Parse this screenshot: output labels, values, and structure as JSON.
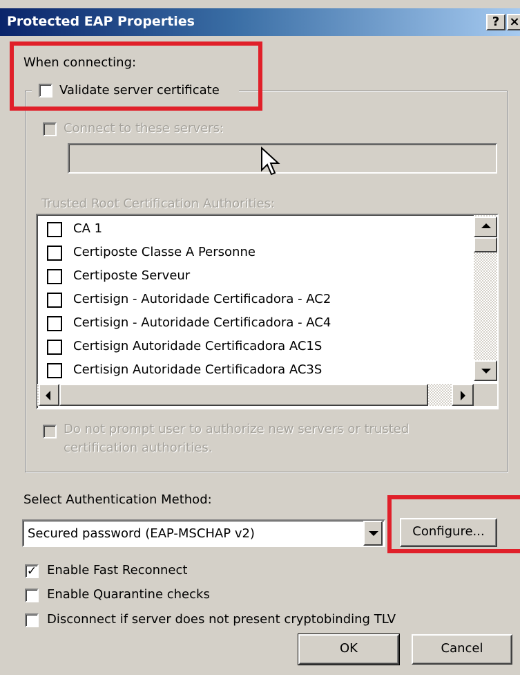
{
  "window": {
    "title": "Protected EAP Properties",
    "help_label": "?",
    "close_label": "×"
  },
  "when_connecting": {
    "label": "When connecting:",
    "validate_label": "Validate server certificate",
    "validate_checked": false,
    "connect_label": "Connect to these servers:",
    "connect_checked": false,
    "servers_value": "",
    "trusted_label": "Trusted Root Certification Authorities:",
    "trusted_items": [
      {
        "label": "CA 1",
        "checked": false
      },
      {
        "label": "Certiposte Classe A Personne",
        "checked": false
      },
      {
        "label": "Certiposte Serveur",
        "checked": false
      },
      {
        "label": "Certisign - Autoridade Certificadora - AC2",
        "checked": false
      },
      {
        "label": "Certisign - Autoridade Certificadora - AC4",
        "checked": false
      },
      {
        "label": "Certisign Autoridade Certificadora AC1S",
        "checked": false
      },
      {
        "label": "Certisign Autoridade Certificadora AC3S",
        "checked": false
      }
    ],
    "prompt_line1": "Do not prompt user to authorize new servers or trusted",
    "prompt_line2": "certification authorities.",
    "prompt_checked": false
  },
  "auth": {
    "label": "Select Authentication Method:",
    "method_value": "Secured password (EAP-MSCHAP v2)",
    "configure_label": "Configure..."
  },
  "options": {
    "fast_reconnect_label": "Enable Fast Reconnect",
    "fast_reconnect_checked": true,
    "quarantine_label": "Enable Quarantine checks",
    "quarantine_checked": false,
    "cryptobinding_label": "Disconnect if server does not present cryptobinding TLV",
    "cryptobinding_checked": false
  },
  "buttons": {
    "ok_label": "OK",
    "cancel_label": "Cancel"
  },
  "colors": {
    "highlight_red": "#e0202a",
    "dialog_face": "#d4d0c8",
    "title_start": "#0a246a",
    "title_end": "#a6caf0"
  }
}
